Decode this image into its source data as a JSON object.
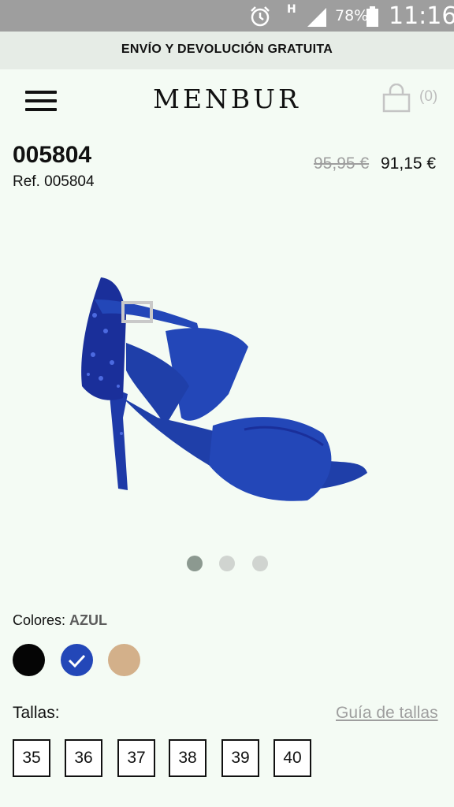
{
  "status_bar": {
    "network": "H",
    "battery_percent": "78%",
    "time": "11:16",
    "icons": [
      "alarm-icon",
      "signal-icon",
      "battery-icon"
    ]
  },
  "promo": {
    "text": "ENVÍO Y DEVOLUCIÓN GRATUITA"
  },
  "header": {
    "logo": "MENBUR",
    "cart_count": "(0)",
    "icons": [
      "menu-icon",
      "shopping-bag-icon"
    ]
  },
  "product": {
    "title": "005804",
    "ref": "Ref. 005804",
    "old_price": "95,95 €",
    "price": "91,15 €",
    "image_alt": "blue-heel-sandal",
    "gallery": {
      "count": 3,
      "active_index": 0
    }
  },
  "colors": {
    "label": "Colores:",
    "selected": "AZUL",
    "swatches": [
      {
        "color": "#050505",
        "selected": false
      },
      {
        "color": "#2347b8",
        "selected": true
      },
      {
        "color": "#d3b08a",
        "selected": false
      }
    ]
  },
  "sizes": {
    "label": "Tallas:",
    "guide_link": "Guía de tallas",
    "options": [
      "35",
      "36",
      "37",
      "38",
      "39",
      "40"
    ]
  },
  "theme": {
    "accent_blue": "#2347b8",
    "status_bar_bg": "#9e9e9e",
    "promo_bg": "#e6ece6",
    "page_bg": "#f4fbf4"
  }
}
